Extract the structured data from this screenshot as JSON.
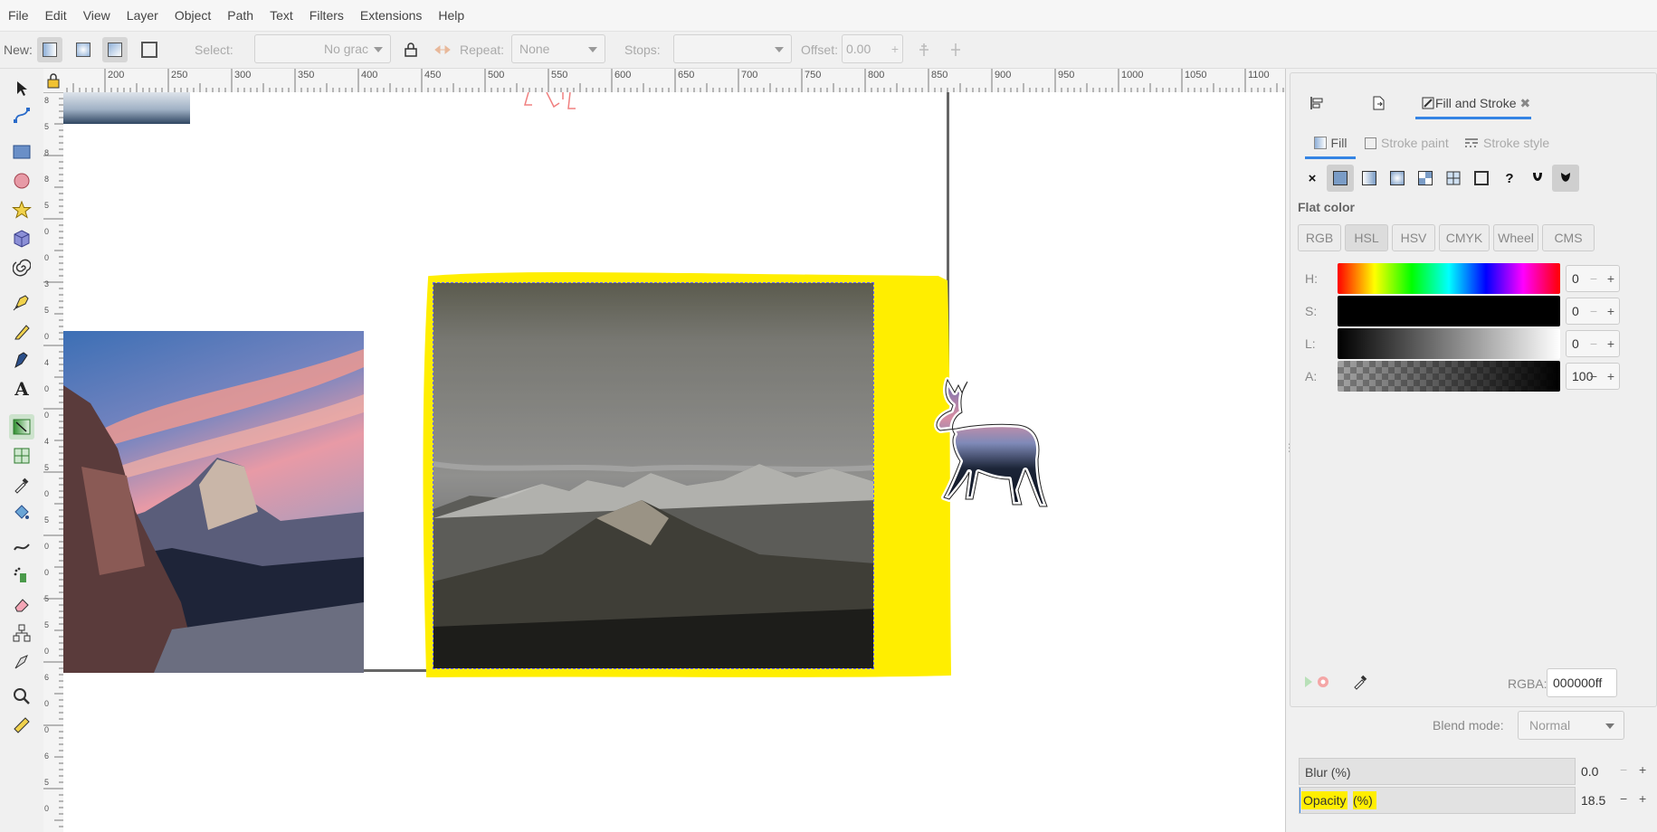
{
  "menu": [
    "File",
    "Edit",
    "View",
    "Layer",
    "Object",
    "Path",
    "Text",
    "Filters",
    "Extensions",
    "Help"
  ],
  "toolbar": {
    "new_label": "New:",
    "select_label": "Select:",
    "select_value": "No grac",
    "repeat_label": "Repeat:",
    "repeat_value": "None",
    "stops_label": "Stops:",
    "offset_label": "Offset:",
    "offset_value": "0.00"
  },
  "ruler_ticks": [
    "200",
    "250",
    "300",
    "350",
    "400",
    "450",
    "500",
    "550",
    "600",
    "650",
    "700",
    "750",
    "800",
    "850",
    "900",
    "950",
    "1000",
    "1050",
    "1100"
  ],
  "vruler_ticks": [
    "8",
    "5",
    "8",
    "8",
    "5",
    "0",
    "0",
    "3",
    "5",
    "0",
    "4",
    "0",
    "0",
    "4",
    "5",
    "0",
    "5",
    "0",
    "0",
    "5",
    "5",
    "0",
    "6",
    "0",
    "0",
    "6",
    "5",
    "0"
  ],
  "dock": {
    "tabs": [
      "Fill and Stroke"
    ],
    "subtabs": {
      "fill": "Fill",
      "stroke_paint": "Stroke paint",
      "stroke_style": "Stroke style"
    },
    "paint_buttons": [
      "×",
      "?"
    ],
    "flat_color_label": "Flat color",
    "modes": [
      "RGB",
      "HSL",
      "HSV",
      "CMYK",
      "Wheel",
      "CMS"
    ],
    "active_mode": "HSL",
    "channels": [
      {
        "label": "H:",
        "value": "0"
      },
      {
        "label": "S:",
        "value": "0"
      },
      {
        "label": "L:",
        "value": "0"
      },
      {
        "label": "A:",
        "value": "100"
      }
    ],
    "rgba_label": "RGBA:",
    "rgba_value": "000000ff",
    "blend_label": "Blend mode:",
    "blend_value": "Normal",
    "blur_label": "Blur (%)",
    "blur_value": "0.0",
    "opacity_label_highlight": "Opacity",
    "opacity_label_rest": " (%)",
    "opacity_value": "18.5",
    "opacity_fraction": 0.185
  },
  "colors": {
    "accent": "#3584e4",
    "highlight": "#ffee00",
    "selection": "#6666ff"
  }
}
